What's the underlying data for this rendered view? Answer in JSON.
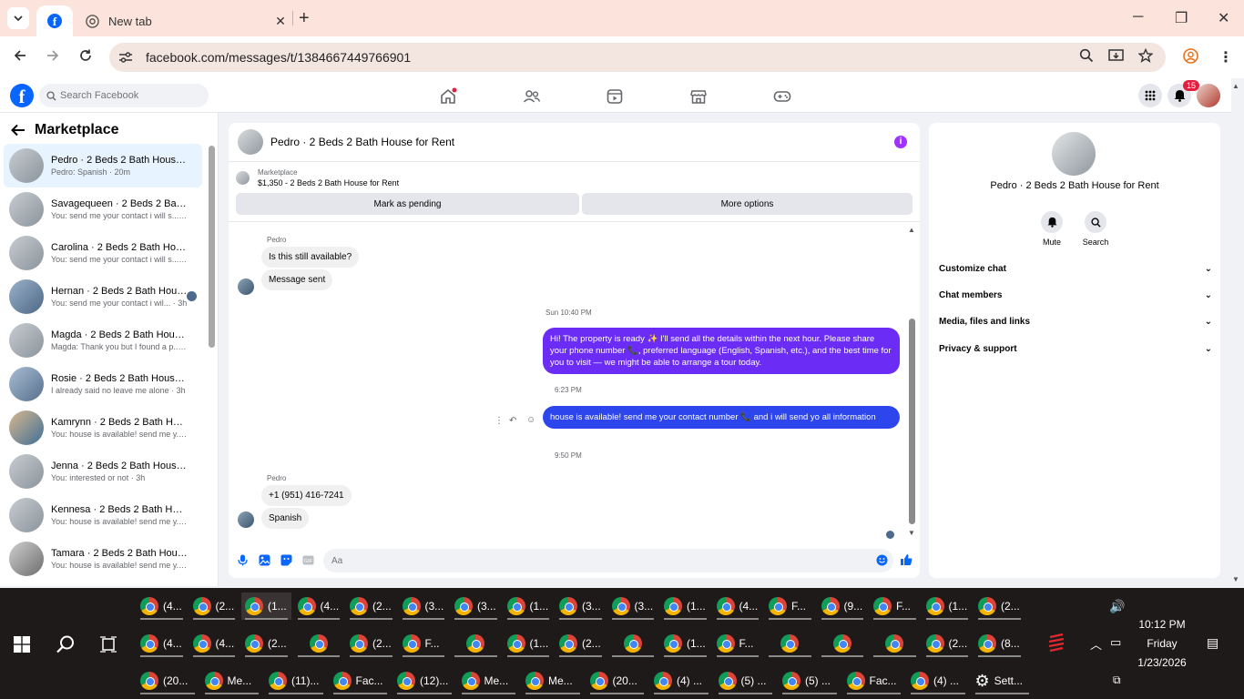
{
  "browser": {
    "tab_facebook_title": "Facebook",
    "tab_new_title": "New tab",
    "url": "facebook.com/messages/t/1384667449766901"
  },
  "fb": {
    "search_placeholder": "Search Facebook",
    "notification_count": "15"
  },
  "left": {
    "title": "Marketplace",
    "conversations": [
      {
        "name": "Pedro · 2 Beds 2 Bath House fo...",
        "preview": "Pedro: Spanish · 20m"
      },
      {
        "name": "Savagequeen · 2 Beds 2 Bath H...",
        "preview": "You: send me your contact i will s... · 3h"
      },
      {
        "name": "Carolina · 2 Beds 2 Bath House ...",
        "preview": "You: send me your contact i will s... · 3h"
      },
      {
        "name": "Hernan · 2 Beds 2 Bath Hous...",
        "preview": "You: send me your contact i wil... · 3h"
      },
      {
        "name": "Magda · 2 Beds 2 Bath House f...",
        "preview": "Magda: Thank you but I found a p... · 3h"
      },
      {
        "name": "Rosie · 2 Beds 2 Bath House for...",
        "preview": "I already said no leave me alone · 3h"
      },
      {
        "name": "Kamrynn · 2 Beds 2 Bath House...",
        "preview": "You: house is available! send me y... · 3h"
      },
      {
        "name": "Jenna · 2 Beds 2 Bath House fo...",
        "preview": "You: interested or not · 3h"
      },
      {
        "name": "Kennesa · 2 Beds 2 Bath House ...",
        "preview": "You: house is available! send me y... · 3h"
      },
      {
        "name": "Tamara · 2 Beds 2 Bath House f...",
        "preview": "You: house is available! send me y... · 3h"
      }
    ]
  },
  "chat": {
    "title": "Pedro · 2 Beds 2 Bath House for Rent",
    "listing_label": "Marketplace",
    "listing_title": "$1,350 - 2 Beds 2 Bath House for Rent",
    "btn_pending": "Mark as pending",
    "btn_more": "More options",
    "sender1": "Pedro",
    "msg1": "Is this still available?",
    "msg2": "Message sent",
    "time1": "Sun 10:40 PM",
    "out1": "Hi! The property is ready ✨ I'll send all the details within the next hour. Please share your phone number 📞, preferred language (English, Spanish, etc.), and the best time for you to visit — we might be able to arrange a tour today.",
    "time2": "6:23 PM",
    "out2": "house is available! send me your contact number 📞 and i will send yo all information",
    "time3": "9:50 PM",
    "sender2": "Pedro",
    "msg3": "+1 (951) 416-7241",
    "msg4": "Spanish",
    "input_placeholder": "Aa"
  },
  "right": {
    "title": "Pedro · 2 Beds 2 Bath House for Rent",
    "mute_label": "Mute",
    "search_label": "Search",
    "sections": [
      "Customize chat",
      "Chat members",
      "Media, files and links",
      "Privacy & support"
    ]
  },
  "taskbar": {
    "row1": [
      "(4...",
      "(2...",
      "(1...",
      "(4...",
      "(2...",
      "(3...",
      "(3...",
      "(1...",
      "(3...",
      "(3...",
      "(1...",
      "(4...",
      "F...",
      "(9...",
      "F...",
      "(1...",
      "(2..."
    ],
    "row2": [
      "(4...",
      "(4...",
      "(2...",
      "",
      "(2...",
      "F...",
      "",
      "(1...",
      "(2...",
      "",
      "(1...",
      "F...",
      "",
      "",
      "",
      "(2...",
      "(8..."
    ],
    "row3": [
      "(20...",
      "Me...",
      "(11)...",
      "Fac...",
      "(12)...",
      "Me...",
      "Me...",
      "(20...",
      "(4) ...",
      "(5) ...",
      "(5) ...",
      "Fac...",
      "(4) ...",
      "Sett..."
    ],
    "time": "10:12 PM",
    "day": "Friday",
    "date": "1/23/2026"
  },
  "colors": {
    "fb_blue": "#0866ff",
    "bubble_purple": "#6b2cf5",
    "bubble_blue": "#2d45ec",
    "tab_bar": "#fce4dc",
    "taskbar": "#1f1a1a"
  }
}
